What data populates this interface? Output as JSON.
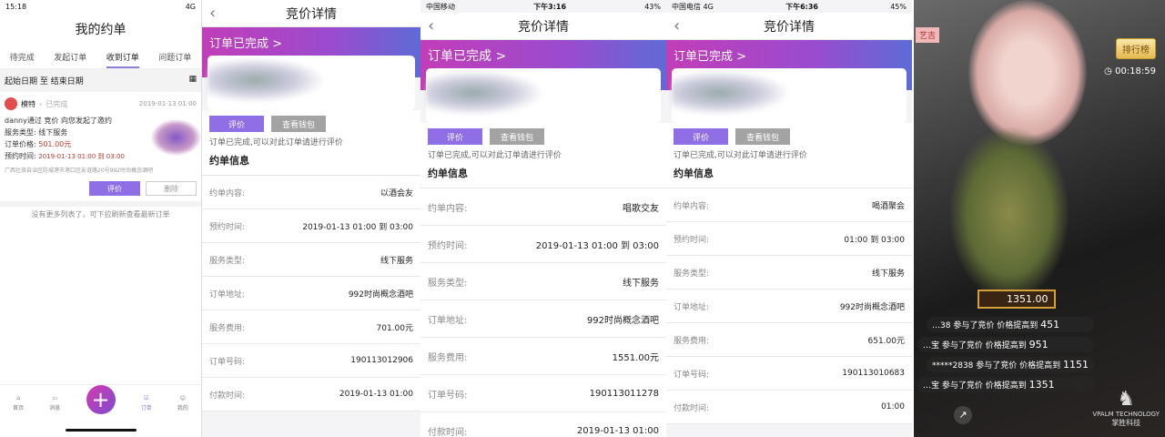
{
  "p1": {
    "status": {
      "time": "15:18",
      "net": "4G"
    },
    "title": "我的约单",
    "tabs": [
      "待完成",
      "发起订单",
      "收到订单",
      "问题订单"
    ],
    "date_start": "起始日期",
    "date_to": "至",
    "date_end": "结束日期",
    "order": {
      "user": "模特",
      "state": "已完成",
      "time": "2019-01-13 01:00",
      "line1": "danny通过 竞价 向您发起了邀约",
      "type_label": "服务类型:",
      "type": "线下服务",
      "price_label": "订单价格:",
      "price": "501.00元",
      "appt_label": "预约时间:",
      "appt": "2019-01-13 01:00 到 03:00",
      "address": "广西壮族自治区防城港市港口区友谊路20号992时尚概念酒吧",
      "rate": "评价",
      "delete": "删除"
    },
    "more": "没有更多列表了，可下拉刷新查看最新订单",
    "tabbar": [
      "首页",
      "消息",
      "订单",
      "我的"
    ]
  },
  "detail_common": {
    "title": "竞价详情",
    "status": "订单已完成 >",
    "rate": "评价",
    "wallet": "查看钱包",
    "hint": "订单已完成,可以对此订单请进行评价",
    "section": "约单信息",
    "labels": [
      "约单内容:",
      "预约时间:",
      "服务类型:",
      "订单地址:",
      "服务费用:",
      "订单号码:",
      "付款时间:"
    ]
  },
  "p2": {
    "values": [
      "以酒会友",
      "2019-01-13 01:00 到 03:00",
      "线下服务",
      "992时尚概念酒吧",
      "701.00元",
      "190113012906",
      "2019-01-13 01:00"
    ]
  },
  "p3": {
    "status": {
      "carrier": "中国移动",
      "time": "下午3:16",
      "battery": "43%"
    },
    "values": [
      "唱歌交友",
      "2019-01-13 01:00 到 03:00",
      "线下服务",
      "992时尚概念酒吧",
      "1551.00元",
      "190113011278",
      "2019-01-13 01:00"
    ]
  },
  "p4": {
    "status": {
      "carrier": "中国电信 4G",
      "time": "下午6:36",
      "battery": "45%"
    },
    "values": [
      "喝酒聚会",
      "01:00 到 03:00",
      "线下服务",
      "992时尚概念酒吧",
      "651.00元",
      "190113010683",
      "01:00"
    ]
  },
  "p5": {
    "tag": "艺吉",
    "rank": "排行榜",
    "timer": "00:18:59",
    "current_bid": "1351.00",
    "bids": [
      {
        "user": "…38",
        "text": "参与了竞价 价格提高到",
        "amount": "451"
      },
      {
        "user": "…宝",
        "text": "参与了竞价 价格提高到",
        "amount": "951"
      },
      {
        "user": "*****2838",
        "text": "参与了竞价 价格提高到",
        "amount": "1151"
      },
      {
        "user": "…宝",
        "text": "参与了竞价 价格提高到",
        "amount": "1351"
      }
    ],
    "logo_en": "VPALM TECHNOLOGY",
    "logo_cn": "掌胜科技"
  }
}
